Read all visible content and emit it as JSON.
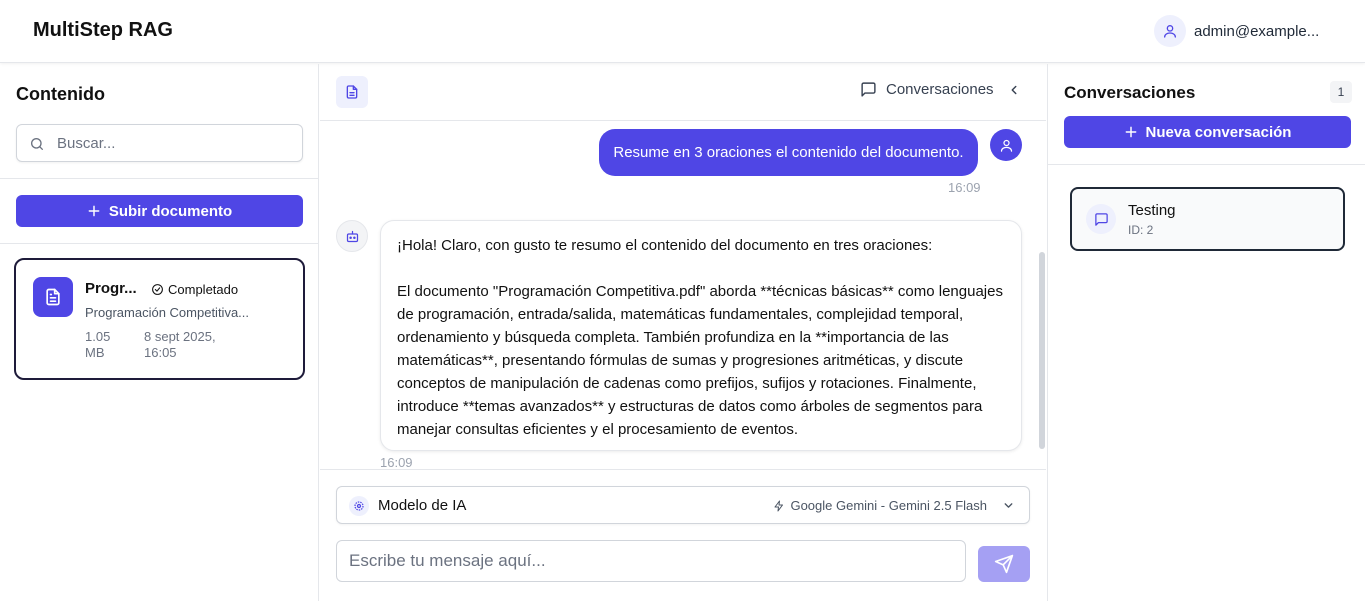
{
  "app": {
    "title": "MultiStep RAG",
    "user_email": "admin@example...",
    "accent_color": "#4f46e5"
  },
  "content_panel": {
    "title": "Contenido",
    "search_placeholder": "Buscar...",
    "upload_label": "Subir documento",
    "documents": [
      {
        "name": "Progr...",
        "status": "Completado",
        "filename": "Programación Competitiva...",
        "size": "1.05 MB",
        "date": "8 sept 2025, 16:05",
        "icon": "document-icon"
      }
    ]
  },
  "chat": {
    "header_button_label": "Conversaciones",
    "messages": [
      {
        "role": "user",
        "text": "Resume en 3 oraciones el contenido del documento.",
        "time": "16:09"
      },
      {
        "role": "assistant",
        "paragraphs": [
          "¡Hola! Claro, con gusto te resumo el contenido del documento en tres oraciones:",
          "El documento \"Programación Competitiva.pdf\" aborda **técnicas básicas** como lenguajes de programación, entrada/salida, matemáticas fundamentales, complejidad temporal, ordenamiento y búsqueda completa. También profundiza en la **importancia de las matemáticas**, presentando fórmulas de sumas y progresiones aritméticas, y discute conceptos de manipulación de cadenas como prefijos, sufijos y rotaciones. Finalmente, introduce **temas avanzados** y estructuras de datos como árboles de segmentos para manejar consultas eficientes y el procesamiento de eventos."
        ],
        "time": "16:09"
      }
    ],
    "model_selector": {
      "label": "Modelo de IA",
      "value": "Google Gemini - Gemini 2.5 Flash"
    },
    "input_placeholder": "Escribe tu mensaje aquí..."
  },
  "conversations_panel": {
    "title": "Conversaciones",
    "count": "1",
    "new_label": "Nueva conversación",
    "items": [
      {
        "name": "Testing",
        "id_label": "ID: 2"
      }
    ]
  }
}
